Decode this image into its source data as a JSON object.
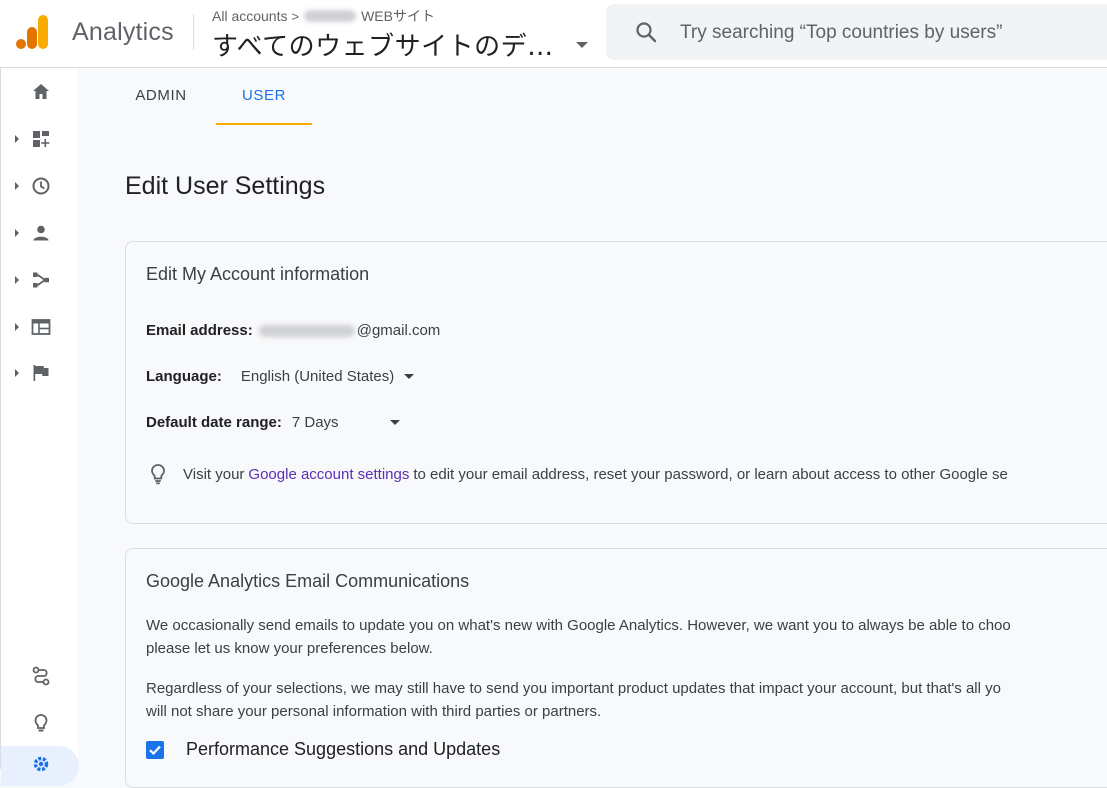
{
  "header": {
    "brand": "Analytics",
    "breadcrumb": {
      "root": "All accounts",
      "separator": ">",
      "account_suffix": "WEBサイト"
    },
    "property_name": "すべてのウェブサイトのデ…",
    "search_placeholder": "Try searching “Top countries by users”"
  },
  "colors": {
    "accent_blue": "#1a73e8",
    "tab_underline": "#f9ab00",
    "logo_orange": "#f9ab00",
    "logo_dark_orange": "#e37400",
    "link_purple": "#5b2eb6"
  },
  "sidebar": {
    "items": [
      {
        "icon": "home-icon",
        "has_caret": false
      },
      {
        "icon": "dashboard-add-icon",
        "has_caret": true
      },
      {
        "icon": "clock-icon",
        "has_caret": true
      },
      {
        "icon": "person-icon",
        "has_caret": true
      },
      {
        "icon": "funnel-path-icon",
        "has_caret": true
      },
      {
        "icon": "table-icon",
        "has_caret": true
      },
      {
        "icon": "flag-icon",
        "has_caret": true
      }
    ],
    "bottom_items": [
      {
        "icon": "route-icon"
      },
      {
        "icon": "lightbulb-icon"
      },
      {
        "icon": "gear-icon"
      }
    ]
  },
  "tabs": [
    {
      "label": "ADMIN",
      "active": false
    },
    {
      "label": "USER",
      "active": true
    }
  ],
  "page_title": "Edit User Settings",
  "account_card": {
    "title": "Edit My Account information",
    "email_label": "Email address:",
    "email_domain": "@gmail.com",
    "language_label": "Language:",
    "language_value": "English (United States)",
    "date_range_label": "Default date range:",
    "date_range_value": "7 Days",
    "info_prefix": "Visit your",
    "info_link": "Google account settings",
    "info_suffix": "to edit your email address, reset your password, or learn about access to other Google se"
  },
  "email_card": {
    "title": "Google Analytics Email Communications",
    "para1_line1": "We occasionally send emails to update you on what's new with Google Analytics. However, we want you to always be able to choo",
    "para1_line2": "please let us know your preferences below.",
    "para2_line1": "Regardless of your selections, we may still have to send you important product updates that impact your account, but that's all yo",
    "para2_line2": "will not share your personal information with third parties or partners.",
    "checkbox_label": "Performance Suggestions and Updates",
    "checkbox_checked": true
  }
}
